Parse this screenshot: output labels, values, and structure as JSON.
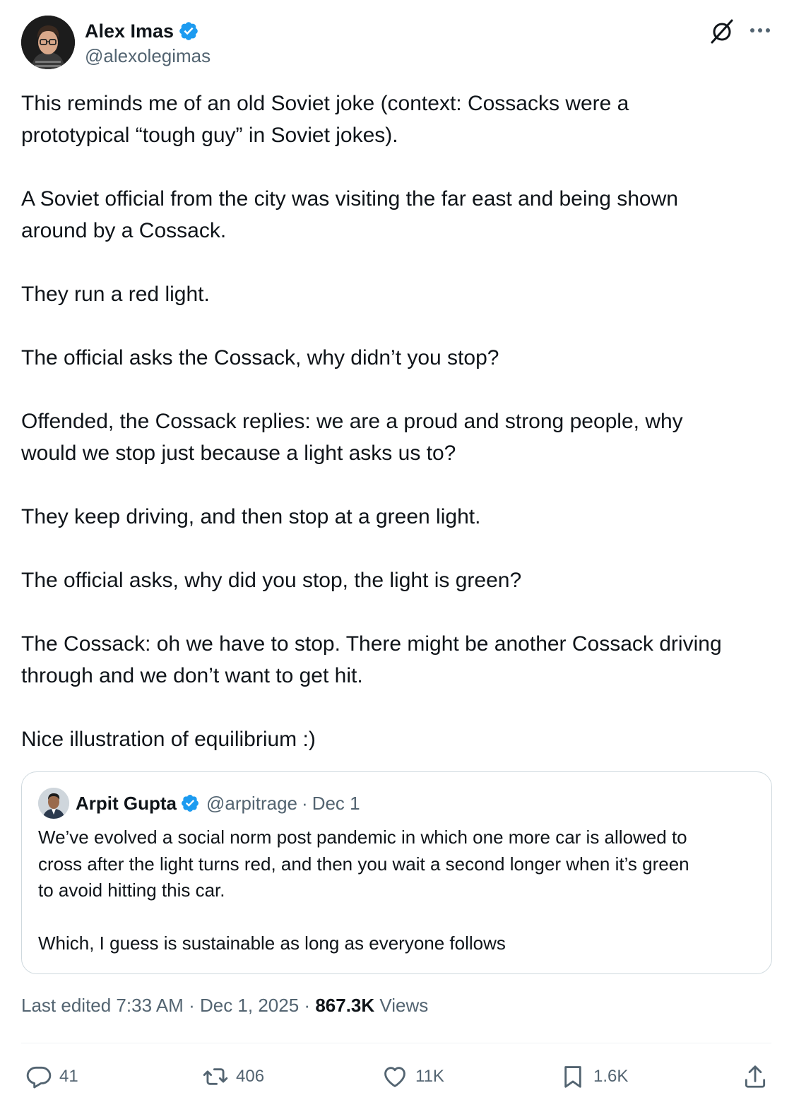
{
  "author": {
    "name": "Alex Imas",
    "handle": "@alexolegimas"
  },
  "body": {
    "paragraphs": [
      "This reminds me of an old Soviet joke (context: Cossacks were a\nprototypical “tough guy” in Soviet jokes).",
      "A Soviet official from the city was visiting the far east and being shown\naround by a Cossack.",
      "They run a red light.",
      "The official asks the Cossack, why didn’t you stop?",
      "Offended, the Cossack replies: we are a proud and strong people, why\nwould we stop just because a light asks us to?",
      "They keep driving, and then stop at a green light.",
      "The official asks, why did you stop, the light is green?",
      "The Cossack: oh we have to stop. There might be another Cossack driving\nthrough and we don’t want to get hit.",
      "Nice illustration of equilibrium :)"
    ]
  },
  "quote": {
    "name": "Arpit Gupta",
    "handle": "@arpitrage",
    "separator": "·",
    "date": "Dec 1",
    "paragraphs": [
      "We’ve evolved a social norm post pandemic in which one more car is allowed to\ncross after the light turns red, and then you wait a second longer when it’s green\nto avoid hitting this car.",
      "Which, I guess is sustainable as long as everyone follows"
    ]
  },
  "meta": {
    "edited": "Last edited 7:33 AM",
    "sep1": "·",
    "date": "Dec 1, 2025",
    "sep2": "·",
    "views_count": "867.3K",
    "views_label": "Views"
  },
  "actions": {
    "replies": "41",
    "reposts": "406",
    "likes": "11K",
    "bookmarks": "1.6K"
  },
  "colors": {
    "text": "#0f1419",
    "secondary": "#536471",
    "verified": "#1d9bf0",
    "border": "#cfd9de"
  },
  "icons": [
    "verified-badge-icon",
    "grok-icon",
    "more-icon",
    "reply-icon",
    "repost-icon",
    "like-icon",
    "bookmark-icon",
    "share-icon"
  ]
}
